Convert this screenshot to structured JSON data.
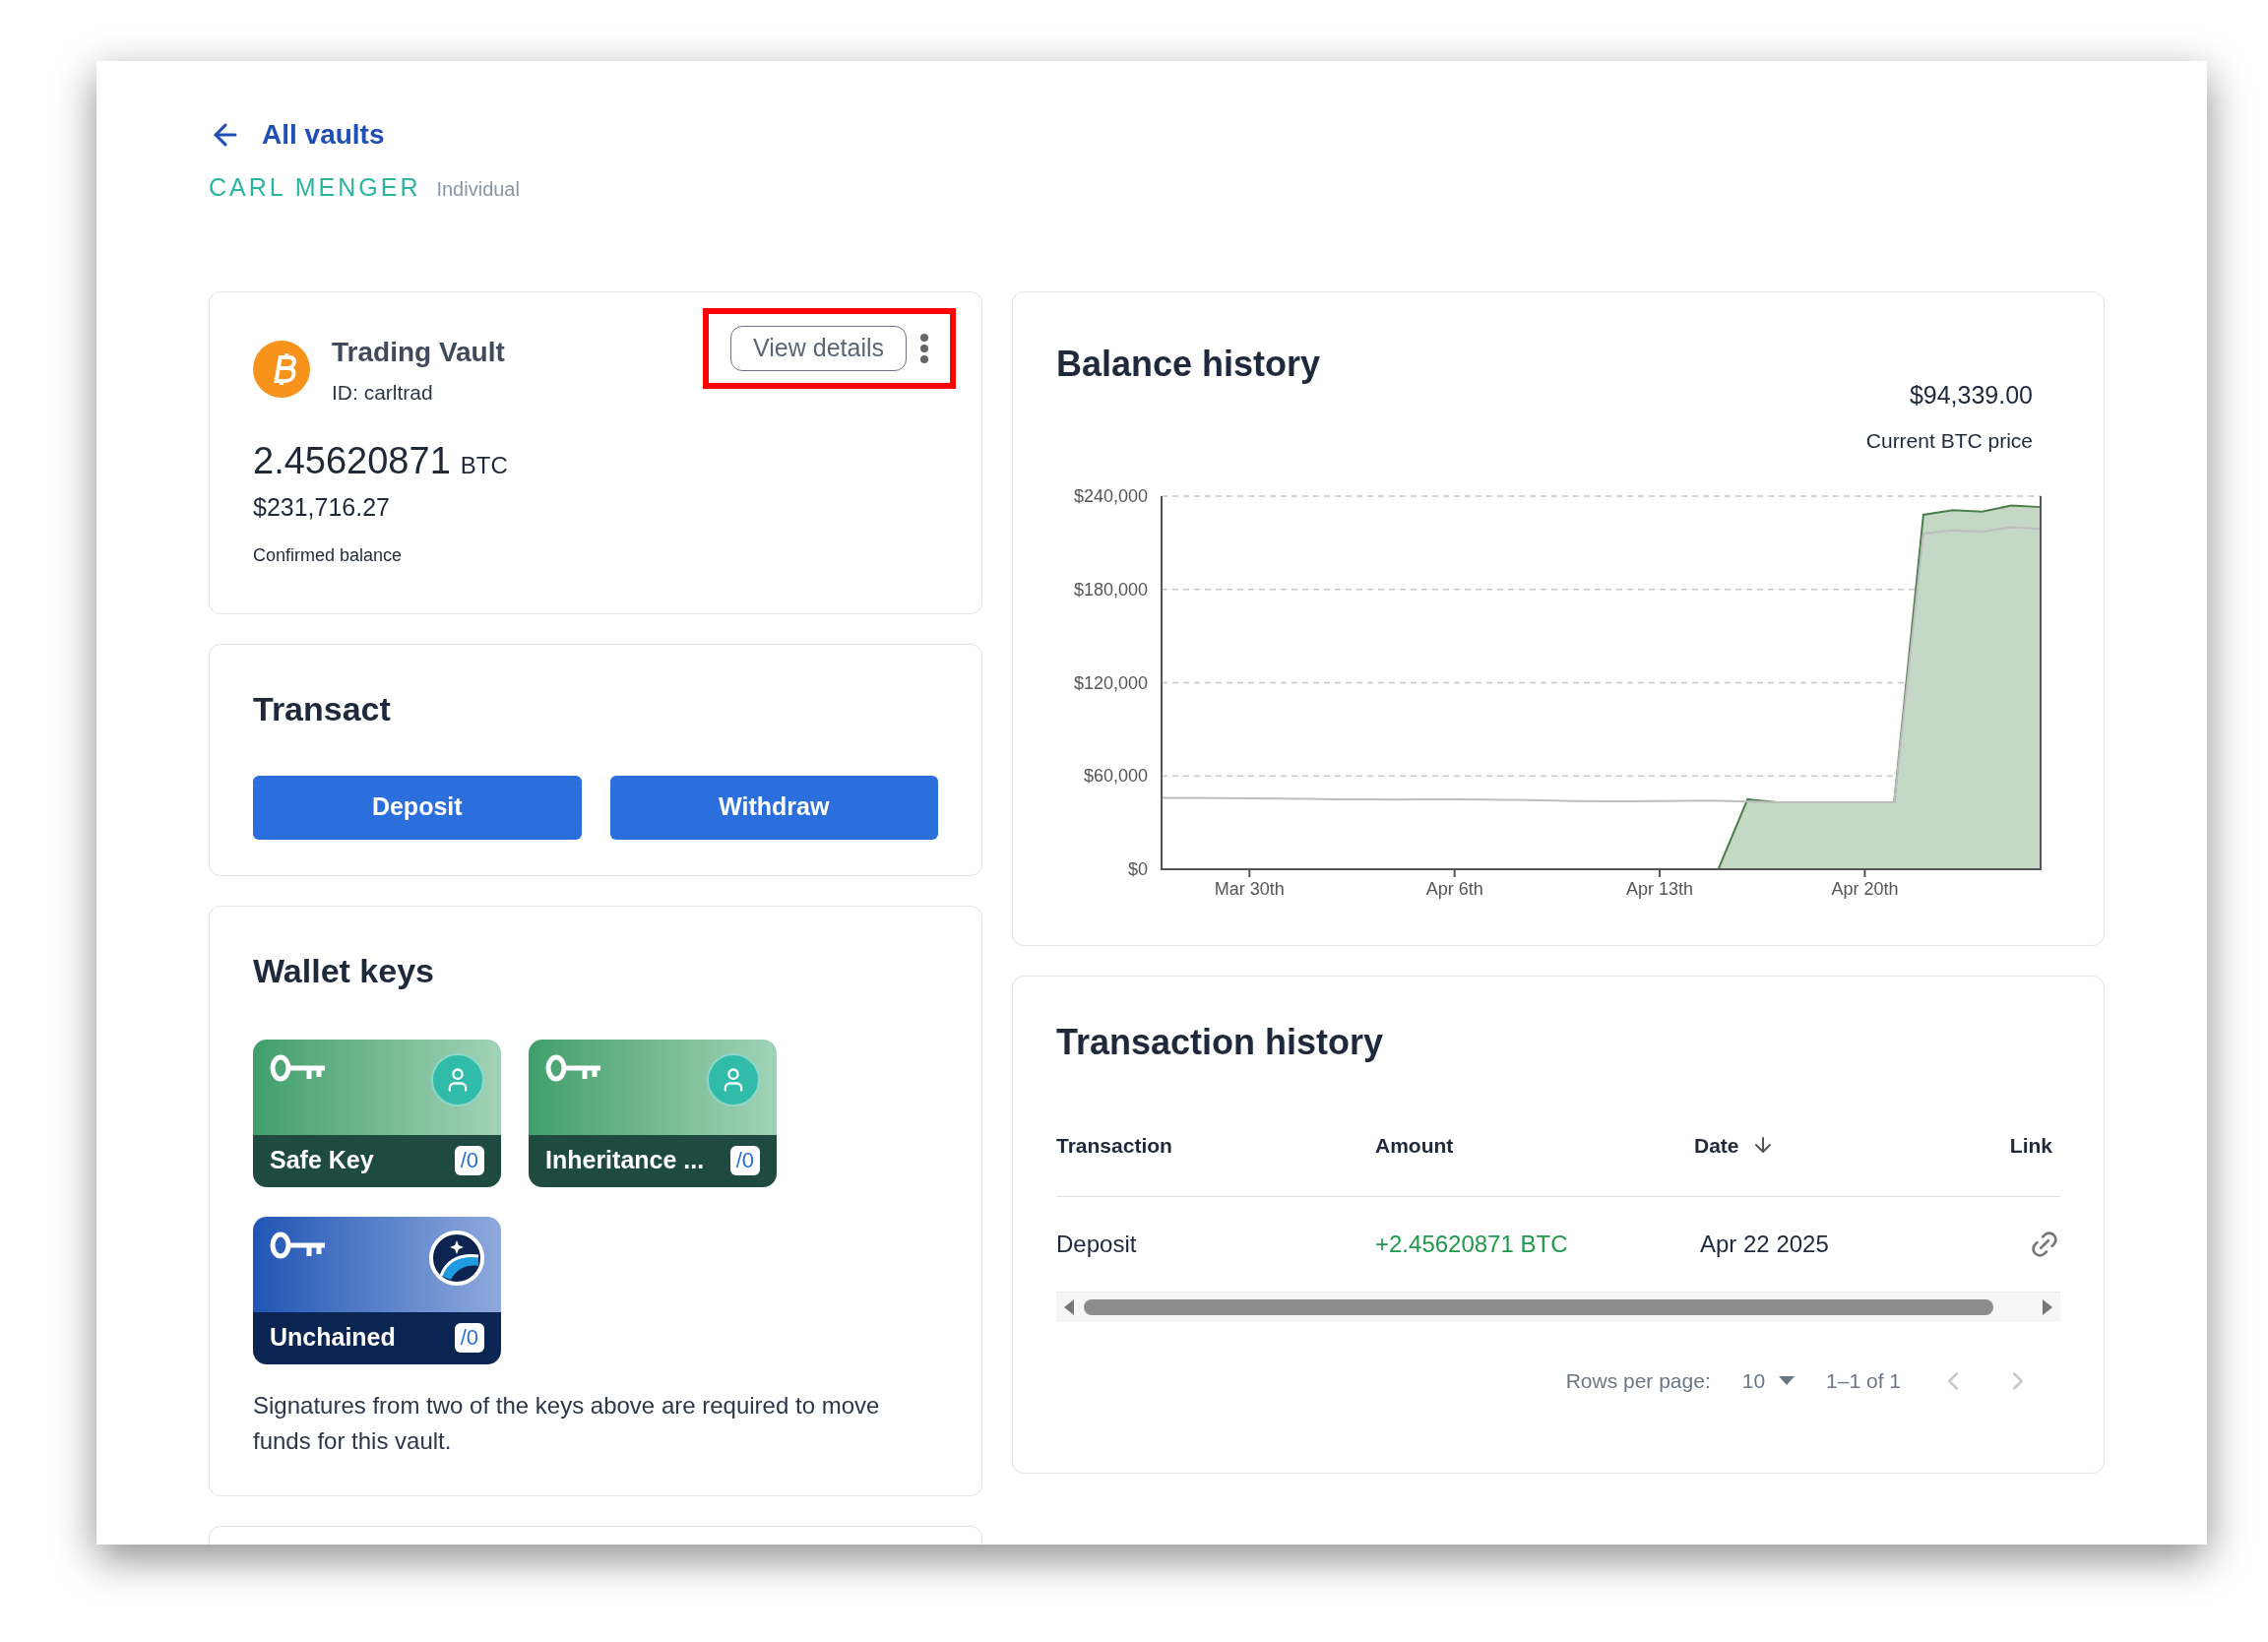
{
  "back_link": {
    "label": "All vaults"
  },
  "owner": {
    "name": "CARL MENGER",
    "type": "Individual"
  },
  "vault": {
    "name": "Trading Vault",
    "id": "ID: carltrad",
    "view_details": {
      "label": "View details",
      "highlighted": true
    },
    "balance_btc": "2.45620871",
    "unit": "BTC",
    "balance_usd": "$231,716.27",
    "balance_label": "Confirmed balance"
  },
  "transact": {
    "title": "Transact",
    "buttons": [
      "Deposit",
      "Withdraw"
    ]
  },
  "wallet_keys": {
    "title": "Wallet keys",
    "keys": [
      {
        "name": "Safe Key",
        "badge": "/0",
        "kind": "person"
      },
      {
        "name": "Inheritance ...",
        "badge": "/0",
        "kind": "person"
      },
      {
        "name": "Unchained",
        "badge": "/0",
        "kind": "logo"
      }
    ],
    "note": "Signatures from two of the keys above are required to move funds for this vault."
  },
  "balance_history": {
    "title": "Balance history",
    "price": "$94,339.00",
    "price_label": "Current BTC price",
    "chart_data": {
      "type": "area",
      "categories": [
        null,
        null,
        null,
        "Mar 30th",
        null,
        null,
        null,
        null,
        null,
        null,
        "Apr 6th",
        null,
        null,
        null,
        null,
        null,
        null,
        "Apr 13th",
        null,
        null,
        null,
        null,
        null,
        null,
        "Apr 20th",
        null,
        null,
        null,
        null,
        null,
        null
      ],
      "series": [
        {
          "type": "area",
          "color": "#4a7f4a",
          "values": [
            0,
            0,
            0,
            0,
            0,
            0,
            0,
            0,
            0,
            0,
            0,
            0,
            0,
            0,
            0,
            0,
            0,
            0,
            0,
            0,
            45000,
            43000,
            43000,
            43000,
            43000,
            43000,
            228000,
            231000,
            230000,
            234000,
            233000
          ]
        },
        {
          "type": "line",
          "color": "#bdbdbd",
          "values": [
            46000,
            46000,
            45800,
            45600,
            45400,
            45200,
            45000,
            45000,
            44800,
            44900,
            45000,
            44800,
            44600,
            44400,
            43800,
            43600,
            43700,
            43800,
            44000,
            44000,
            43500,
            43000,
            43000,
            43000,
            43000,
            43000,
            216000,
            218000,
            217000,
            220000,
            219000
          ]
        }
      ],
      "ylim": [
        0,
        240000
      ],
      "grid": true,
      "yticks": [
        {
          "value": 0,
          "label": "$0"
        },
        {
          "value": 60000,
          "label": "$60,000"
        },
        {
          "value": 120000,
          "label": "$120,000"
        },
        {
          "value": 180000,
          "label": "$180,000"
        },
        {
          "value": 240000,
          "label": "$240,000"
        }
      ]
    }
  },
  "transaction_history": {
    "title": "Transaction history",
    "columns": [
      {
        "label": "Transaction",
        "sorted": false
      },
      {
        "label": "Amount",
        "sorted": false
      },
      {
        "label": "Date",
        "sorted": true
      },
      {
        "label": "Link",
        "sorted": false
      }
    ],
    "rows": [
      {
        "transaction": "Deposit",
        "amount": "+2.45620871 BTC",
        "date": "Apr 22 2025"
      }
    ],
    "pagination": {
      "rows_per_page_label": "Rows per page:",
      "rows_per_page": "10",
      "range": "1–1 of 1",
      "prev_disabled": true,
      "next_disabled": true
    }
  }
}
